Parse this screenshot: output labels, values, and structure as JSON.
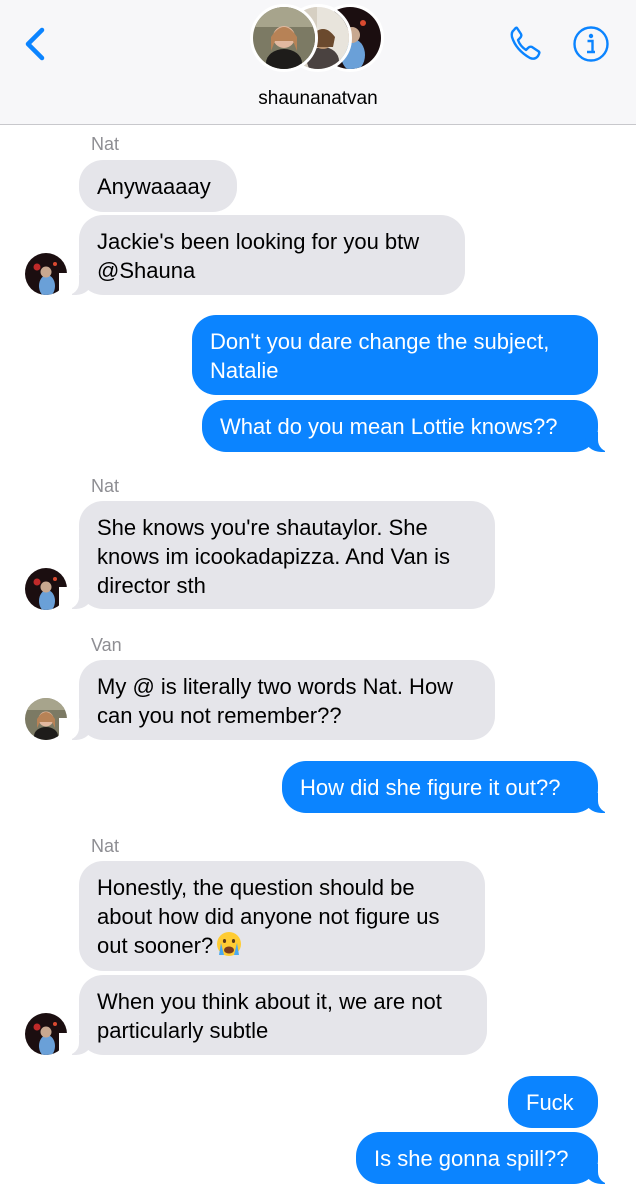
{
  "header": {
    "chat_name": "shaunanatvan",
    "back_icon": "chevron-left-icon",
    "call_icon": "phone-icon",
    "info_icon": "info-icon",
    "accent_color": "#0b84ff"
  },
  "messages": [
    {
      "sender": "Nat"
    },
    {
      "text": "Anywaaaay",
      "direction": "incoming"
    },
    {
      "text": "Jackie's been looking for you btw @Shauna",
      "direction": "incoming"
    },
    {
      "text": "Don't you dare change the subject, Natalie",
      "direction": "outgoing"
    },
    {
      "text": "What do you mean Lottie knows??",
      "direction": "outgoing"
    },
    {
      "sender": "Nat"
    },
    {
      "text": "She knows you're shautaylor. She knows im icookadapizza. And Van is director sth",
      "direction": "incoming"
    },
    {
      "sender": "Van"
    },
    {
      "text": "My @ is literally two words Nat. How can you not remember??",
      "direction": "incoming"
    },
    {
      "text": "How did she figure it out??",
      "direction": "outgoing"
    },
    {
      "sender": "Nat"
    },
    {
      "text": "Honestly, the question should be about how did anyone not figure us out sooner?",
      "emoji": "crying-face-emoji",
      "direction": "incoming"
    },
    {
      "text": "When you think about it, we are not particularly subtle",
      "direction": "incoming"
    },
    {
      "text": "Fuck",
      "direction": "outgoing"
    },
    {
      "text": "Is she gonna spill??",
      "direction": "outgoing"
    }
  ]
}
